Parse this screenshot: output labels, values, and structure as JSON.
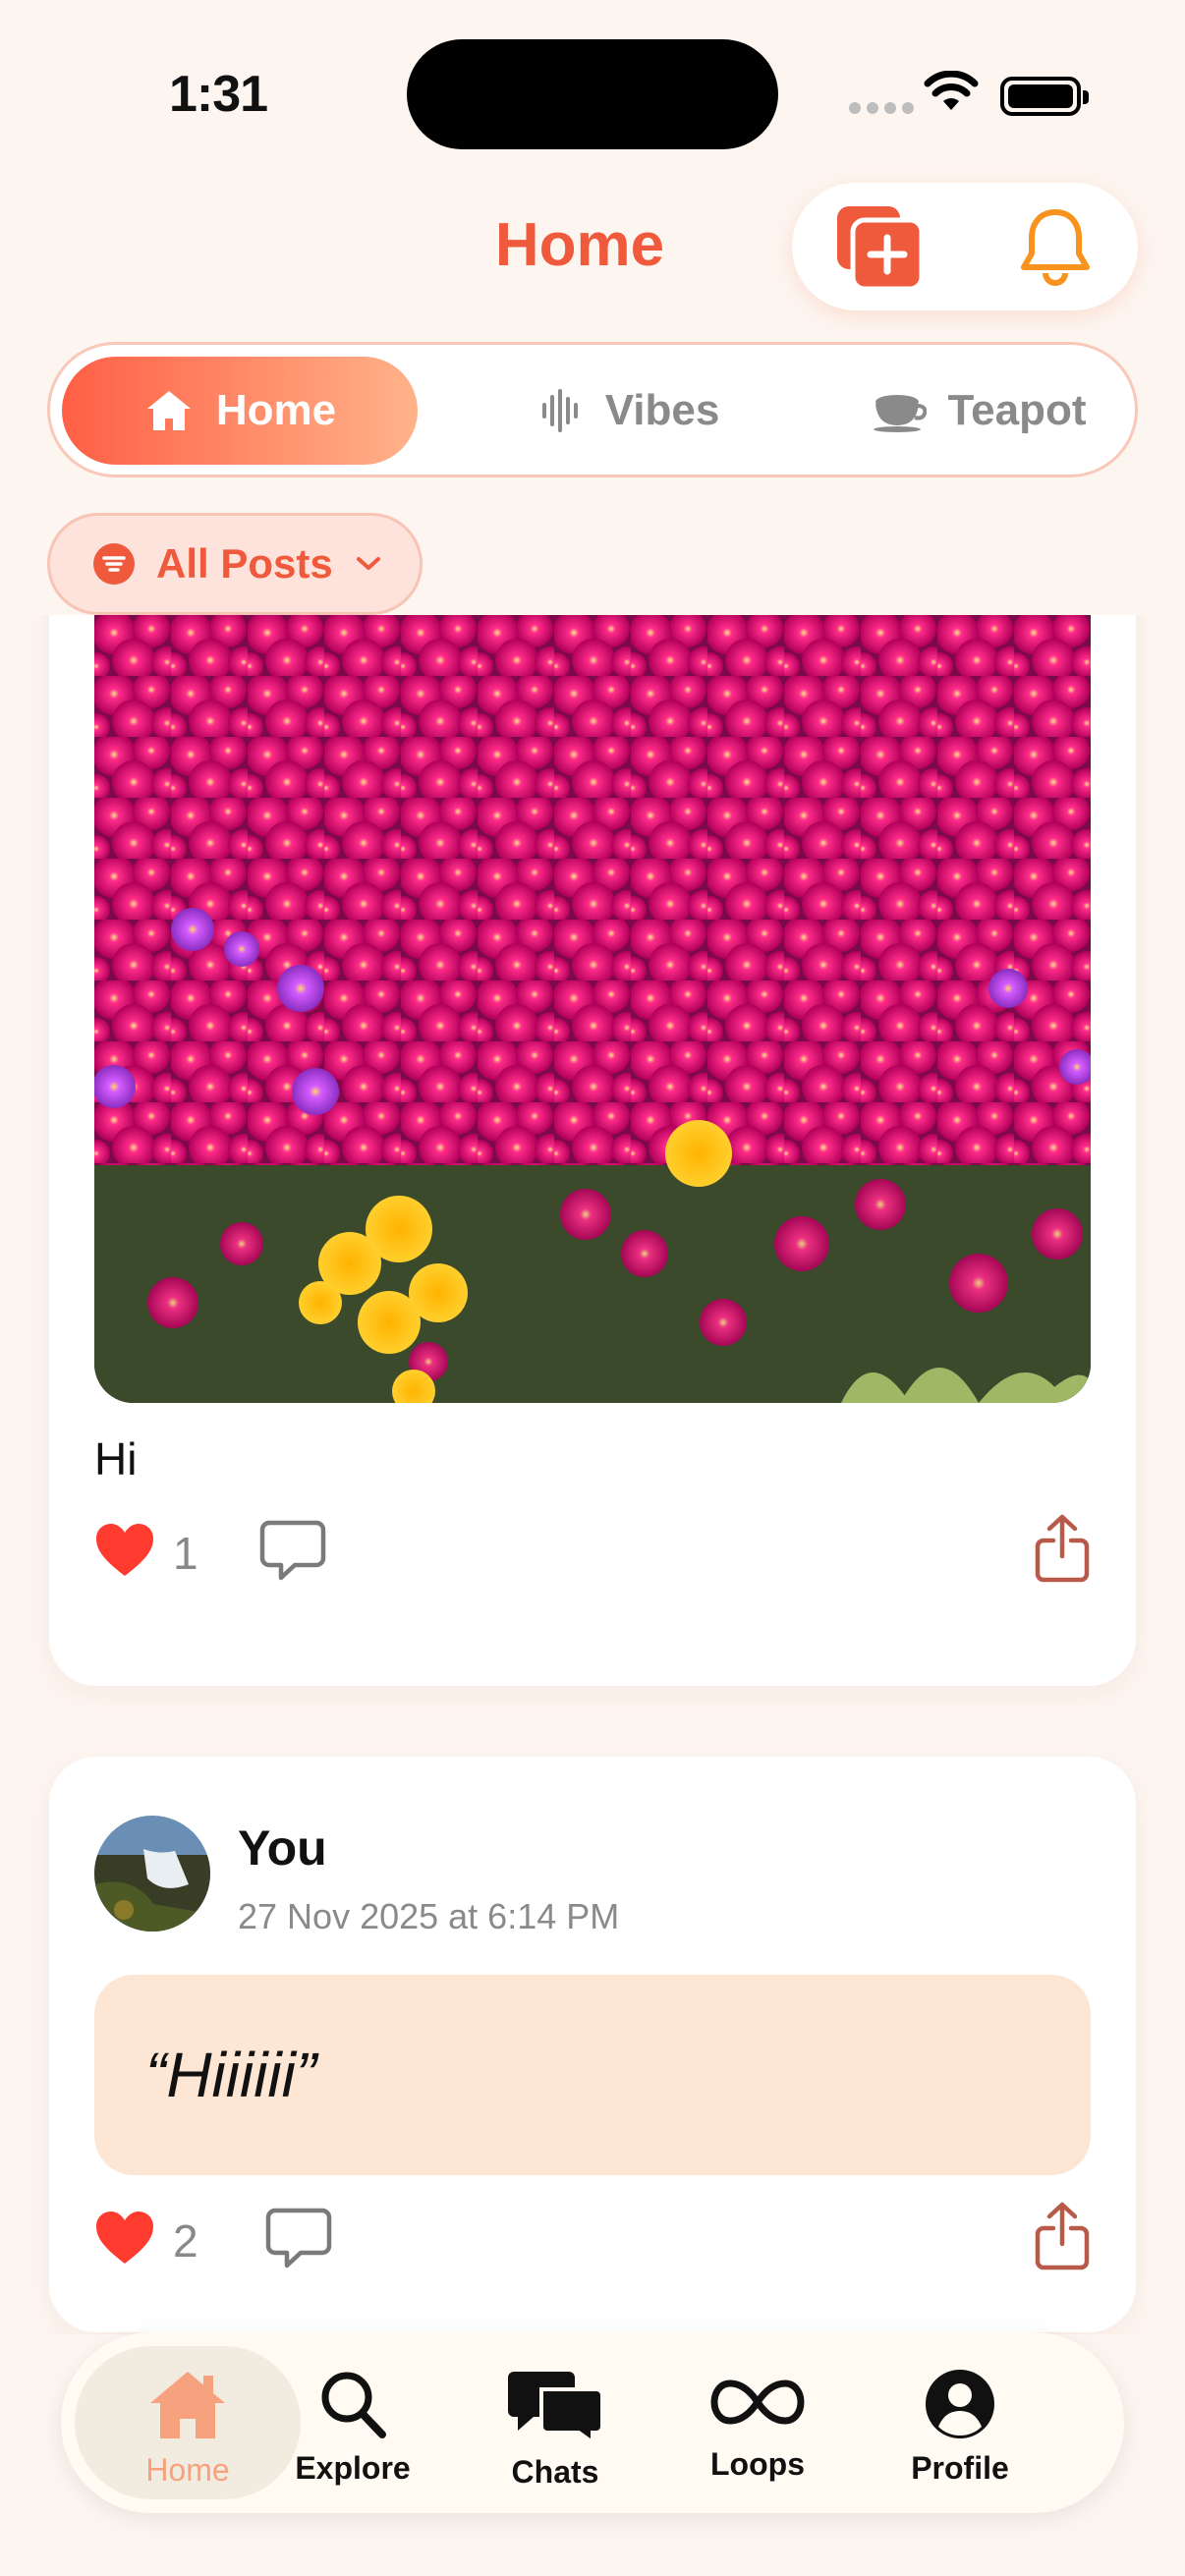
{
  "status_bar": {
    "time": "1:31"
  },
  "header": {
    "title": "Home",
    "new_post_icon": "new-post-icon",
    "notifications_icon": "bell-icon"
  },
  "tabs": [
    {
      "label": "Home",
      "icon": "house-icon",
      "active": true
    },
    {
      "label": "Vibes",
      "icon": "waveform-icon",
      "active": false
    },
    {
      "label": "Teapot",
      "icon": "teacup-icon",
      "active": false
    }
  ],
  "filter": {
    "label": "All Posts",
    "icon": "filter-icon"
  },
  "posts": [
    {
      "image": "flower-field-photo",
      "text": "Hi",
      "likes": "1"
    },
    {
      "author": "You",
      "timestamp": "27 Nov 2025 at 6:14 PM",
      "quote": "“Hiiiiii”",
      "likes": "2"
    }
  ],
  "bottom_nav": [
    {
      "label": "Home",
      "icon": "house-icon",
      "active": true
    },
    {
      "label": "Explore",
      "icon": "magnifier-icon",
      "active": false
    },
    {
      "label": "Chats",
      "icon": "chat-bubbles-icon",
      "active": false
    },
    {
      "label": "Loops",
      "icon": "infinity-icon",
      "active": false
    },
    {
      "label": "Profile",
      "icon": "person-circle-icon",
      "active": false
    }
  ],
  "colors": {
    "accent": "#f05a3c",
    "background": "#fdf5f0",
    "like_red": "#ff3b30",
    "quote_bg": "#fde6d4"
  }
}
